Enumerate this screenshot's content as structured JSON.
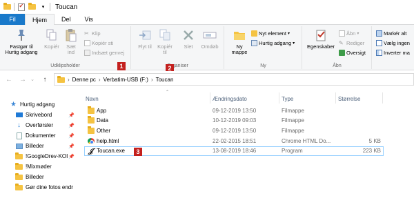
{
  "window": {
    "title": "Toucan"
  },
  "tabs": [
    "Fil",
    "Hjem",
    "Del",
    "Vis"
  ],
  "ribbon": {
    "clipboard": {
      "pin_label": "Fastgør til Hurtig adgang",
      "copy_label": "Kopiér",
      "paste_label": "Sæt ind",
      "cut_label": "Klip",
      "copy_path_label": "Kopiér sti",
      "paste_shortcut_label": "Indsæt genvej",
      "group_label": "Udklipsholder"
    },
    "organize": {
      "move_label": "Flyt til",
      "copy_to_label": "Kopiér til",
      "delete_label": "Slet",
      "rename_label": "Omdøb",
      "group_label": "Organiser"
    },
    "new": {
      "new_folder_label": "Ny mappe",
      "new_item_label": "Nyt element",
      "easy_access_label": "Hurtig adgang",
      "group_label": "Ny"
    },
    "open": {
      "properties_label": "Egenskaber",
      "open_label": "Åbn",
      "edit_label": "Rediger",
      "history_label": "Oversigt",
      "group_label": "Åbn"
    },
    "select": {
      "select_all_label": "Markér alt",
      "select_none_label": "Vælg ingen",
      "invert_label": "Inverter ma"
    }
  },
  "badges": [
    "1",
    "2",
    "3"
  ],
  "address": {
    "segments": [
      "Denne pc",
      "Verbatim-USB (F:)",
      "Toucan"
    ]
  },
  "nav_pane": {
    "items": [
      {
        "label": "Hurtig adgang",
        "icon": "star-icon",
        "pinned": false
      },
      {
        "label": "Skrivebord",
        "icon": "desktop-icon",
        "pinned": true
      },
      {
        "label": "Overførsler",
        "icon": "download-icon",
        "pinned": true
      },
      {
        "label": "Dokumenter",
        "icon": "documents-icon",
        "pinned": true
      },
      {
        "label": "Billeder",
        "icon": "pictures-icon",
        "pinned": true
      },
      {
        "label": "!GoogleDrev-KOI",
        "icon": "folder-icon",
        "pinned": true
      },
      {
        "label": "!Mixmøder",
        "icon": "folder-icon",
        "pinned": false
      },
      {
        "label": "Billeder",
        "icon": "folder-icon",
        "pinned": false
      },
      {
        "label": "Gør dine fotos endr",
        "icon": "folder-icon",
        "pinned": false
      }
    ]
  },
  "columns": {
    "name": "Navn",
    "date": "Ændringsdato",
    "type": "Type",
    "size": "Størrelse"
  },
  "files": [
    {
      "name": "App",
      "date": "09-12-2019 13:50",
      "type": "Filmappe",
      "size": "",
      "icon": "folder-icon"
    },
    {
      "name": "Data",
      "date": "10-12-2019 09:03",
      "type": "Filmappe",
      "size": "",
      "icon": "folder-icon"
    },
    {
      "name": "Other",
      "date": "09-12-2019 13:50",
      "type": "Filmappe",
      "size": "",
      "icon": "folder-icon"
    },
    {
      "name": "help.html",
      "date": "22-02-2015 18:51",
      "type": "Chrome HTML Do...",
      "size": "5 KB",
      "icon": "chrome-icon"
    },
    {
      "name": "Toucan.exe",
      "date": "13-08-2019 18:46",
      "type": "Program",
      "size": "223 KB",
      "icon": "toucan-exe-icon"
    }
  ]
}
